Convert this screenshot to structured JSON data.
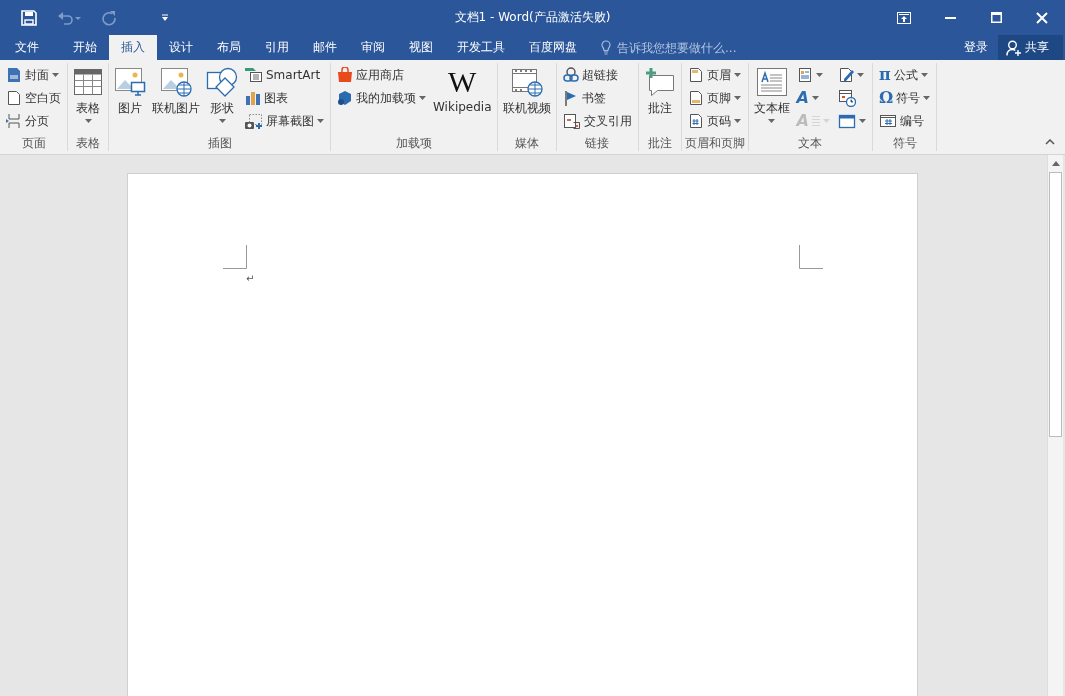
{
  "window": {
    "title": "文档1 - Word(产品激活失败)"
  },
  "quick_access": [
    {
      "disabled": false
    },
    {
      "disabled": true
    },
    {
      "disabled": true
    },
    {
      "disabled": false
    }
  ],
  "tabs": [
    {
      "label": "文件",
      "selected": false
    },
    {
      "label": "开始",
      "selected": false
    },
    {
      "label": "插入",
      "selected": true
    },
    {
      "label": "设计",
      "selected": false
    },
    {
      "label": "布局",
      "selected": false
    },
    {
      "label": "引用",
      "selected": false
    },
    {
      "label": "邮件",
      "selected": false
    },
    {
      "label": "审阅",
      "selected": false
    },
    {
      "label": "视图",
      "selected": false
    },
    {
      "label": "开发工具",
      "selected": false
    },
    {
      "label": "百度网盘",
      "selected": false
    }
  ],
  "tell_me": {
    "placeholder": "告诉我您想要做什么..."
  },
  "account": {
    "sign_in": "登录",
    "share": "共享"
  },
  "ribbon": {
    "groups": [
      {
        "label": "页面",
        "items": [
          {
            "kind": "small",
            "label": "封面",
            "dropdown": true
          },
          {
            "kind": "small",
            "label": "空白页",
            "dropdown": false
          },
          {
            "kind": "small",
            "label": "分页",
            "dropdown": false
          }
        ]
      },
      {
        "label": "表格",
        "items": [
          {
            "kind": "large",
            "label": "表格",
            "dropdown": true
          }
        ]
      },
      {
        "label": "插图",
        "items": [
          {
            "kind": "large",
            "label": "图片",
            "dropdown": false
          },
          {
            "kind": "large",
            "label": "联机图片",
            "dropdown": false
          },
          {
            "kind": "large",
            "label": "形状",
            "dropdown": true
          },
          {
            "kind": "small",
            "label": "SmartArt",
            "dropdown": false
          },
          {
            "kind": "small",
            "label": "图表",
            "dropdown": false
          },
          {
            "kind": "small",
            "label": "屏幕截图",
            "dropdown": true
          }
        ]
      },
      {
        "label": "加载项",
        "items": [
          {
            "kind": "small",
            "label": "应用商店",
            "dropdown": false
          },
          {
            "kind": "small",
            "label": "我的加载项",
            "dropdown": true
          },
          {
            "kind": "large",
            "label": "Wikipedia",
            "logo": "W",
            "dropdown": false
          }
        ]
      },
      {
        "label": "媒体",
        "items": [
          {
            "kind": "large",
            "label": "联机视频",
            "dropdown": false
          }
        ]
      },
      {
        "label": "链接",
        "items": [
          {
            "kind": "small",
            "label": "超链接",
            "dropdown": false
          },
          {
            "kind": "small",
            "label": "书签",
            "dropdown": false
          },
          {
            "kind": "small",
            "label": "交叉引用",
            "dropdown": false
          }
        ]
      },
      {
        "label": "批注",
        "items": [
          {
            "kind": "large",
            "label": "批注",
            "dropdown": false
          }
        ]
      },
      {
        "label": "页眉和页脚",
        "items": [
          {
            "kind": "small",
            "label": "页眉",
            "dropdown": true
          },
          {
            "kind": "small",
            "label": "页脚",
            "dropdown": true
          },
          {
            "kind": "small",
            "label": "页码",
            "dropdown": true
          }
        ]
      },
      {
        "label": "文本",
        "items": [
          {
            "kind": "large",
            "label": "文本框",
            "dropdown": true
          },
          {
            "kind": "icon",
            "dropdown": true,
            "disabled": false
          },
          {
            "kind": "icon",
            "glyph": "A",
            "dropdown": true,
            "disabled": false
          },
          {
            "kind": "icon",
            "glyph": "A",
            "dropdown": true,
            "disabled": true
          },
          {
            "kind": "icon",
            "dropdown": true,
            "disabled": false
          },
          {
            "kind": "icon",
            "dropdown": false,
            "disabled": false
          },
          {
            "kind": "icon",
            "dropdown": true,
            "disabled": false
          }
        ]
      },
      {
        "label": "符号",
        "items": [
          {
            "kind": "small",
            "label": "公式",
            "glyph": "π",
            "dropdown": true
          },
          {
            "kind": "small",
            "label": "符号",
            "glyph": "Ω",
            "dropdown": true
          },
          {
            "kind": "small",
            "label": "编号",
            "dropdown": false
          }
        ]
      }
    ]
  },
  "document": {
    "paragraph_mark": "↵"
  }
}
